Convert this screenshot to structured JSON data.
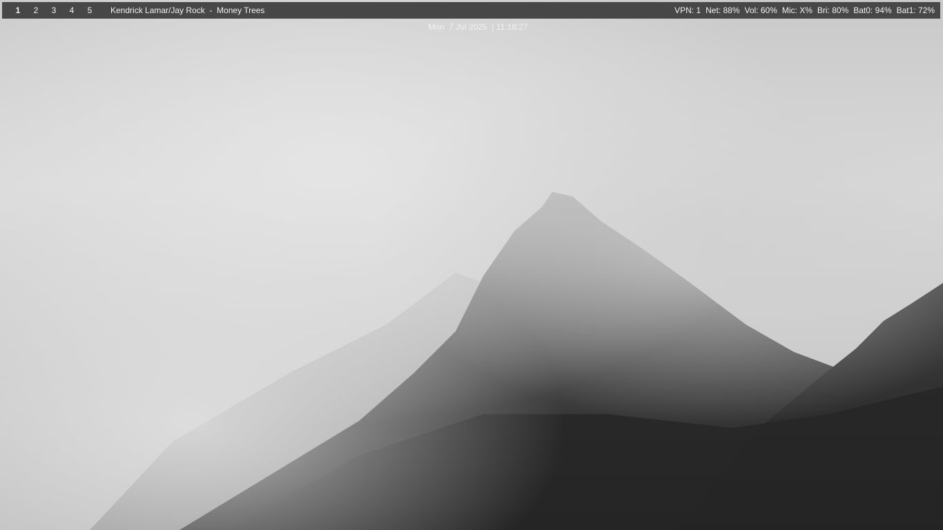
{
  "workspaces": [
    {
      "label": "1",
      "active": true
    },
    {
      "label": "2",
      "active": false
    },
    {
      "label": "3",
      "active": false
    },
    {
      "label": "4",
      "active": false
    },
    {
      "label": "5",
      "active": false
    }
  ],
  "now_playing": {
    "text": "Kendrick Lamar/Jay Rock  -  Money Trees"
  },
  "clock": {
    "text": "Mon  7 Jul 2025  | 11:18:27"
  },
  "status": {
    "vpn": "VPN: 1",
    "net": "Net: 88%",
    "vol": "Vol: 60%",
    "mic": "Mic: X%",
    "bri": "Bri: 80%",
    "bat0": "Bat0: 94%",
    "bat1": "Bat1: 72%"
  },
  "colors": {
    "bar_background": "#474747",
    "bar_text": "#f2f2f2",
    "wallpaper_sky": "#d8d8d8",
    "wallpaper_mountain": "#2b2b2b"
  },
  "wallpaper": {
    "icon": "foggy-mountain-wallpaper"
  }
}
